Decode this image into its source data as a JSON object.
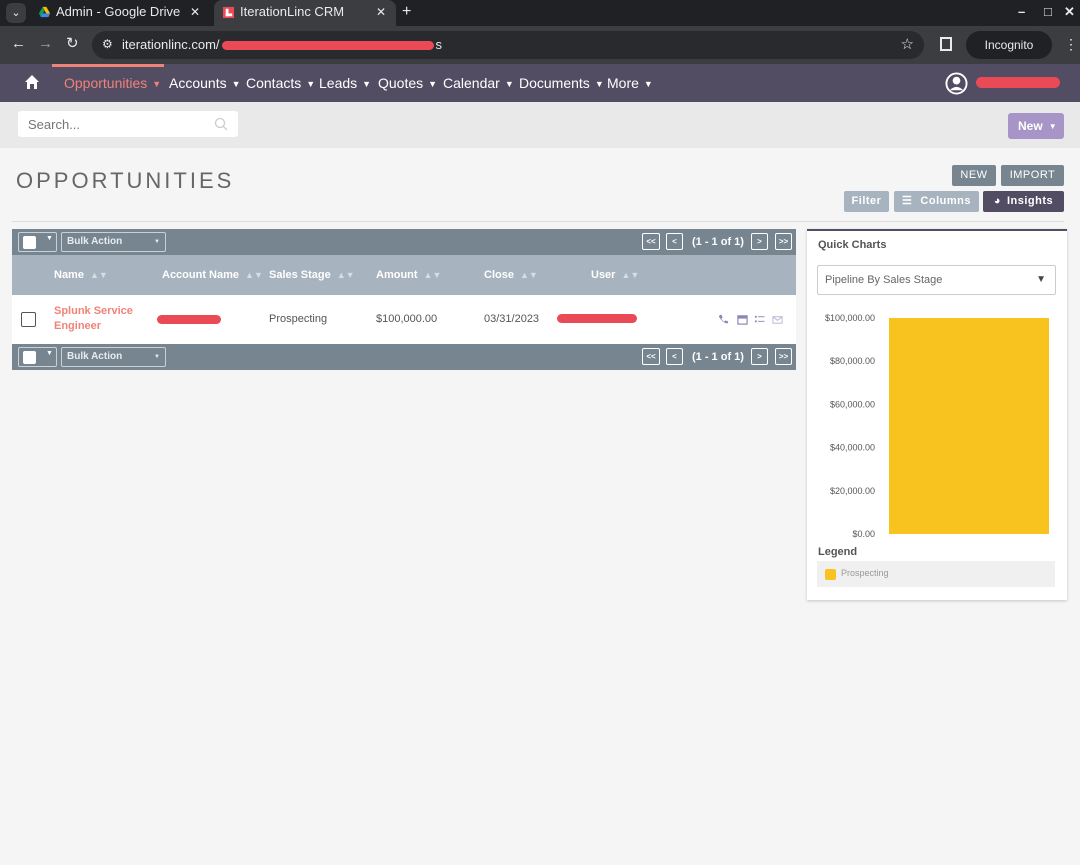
{
  "browser": {
    "tabs": [
      {
        "title": "Admin - Google Drive"
      },
      {
        "title": "IterationLinc CRM"
      }
    ],
    "url_prefix": "iterationlinc.com/",
    "url_suffix": "s",
    "incognito_label": "Incognito"
  },
  "nav": {
    "items": [
      {
        "label": "Opportunities"
      },
      {
        "label": "Accounts"
      },
      {
        "label": "Contacts"
      },
      {
        "label": "Leads"
      },
      {
        "label": "Quotes"
      },
      {
        "label": "Calendar"
      },
      {
        "label": "Documents"
      },
      {
        "label": "More"
      }
    ]
  },
  "search": {
    "placeholder": "Search..."
  },
  "new_menu_label": "New",
  "page": {
    "title": "OPPORTUNITIES",
    "new_label": "NEW",
    "import_label": "IMPORT",
    "filter_label": "Filter",
    "columns_label": "Columns",
    "insights_label": "Insights"
  },
  "list": {
    "bulk_action_label": "Bulk Action",
    "pagination": {
      "first": "<<",
      "prev": "<",
      "info": "(1 - 1 of 1)",
      "next": ">",
      "last": ">>"
    },
    "columns": [
      "Name",
      "Account Name",
      "Sales Stage",
      "Amount",
      "Close",
      "User"
    ],
    "rows": [
      {
        "name": "Splunk Service Engineer",
        "sales_stage": "Prospecting",
        "amount": "$100,000.00",
        "close": "03/31/2023"
      }
    ]
  },
  "quick_charts": {
    "title": "Quick Charts",
    "selected_chart": "Pipeline By Sales Stage",
    "legend_title": "Legend"
  },
  "chart_data": {
    "type": "bar",
    "categories": [
      "Prospecting"
    ],
    "values": [
      100000
    ],
    "ylim": [
      0,
      100000
    ],
    "yticks": [
      "$0.00",
      "$20,000.00",
      "$40,000.00",
      "$60,000.00",
      "$80,000.00",
      "$100,000.00"
    ],
    "colors": [
      "#f9c31f"
    ],
    "legend": [
      "Prospecting"
    ],
    "grid": false
  },
  "colors": {
    "nav_bg": "#534d64",
    "accent": "#f08377",
    "toolbar": "#778591",
    "header": "#a7b4bf",
    "new_button": "#a695c6",
    "bar": "#f9c31f"
  }
}
